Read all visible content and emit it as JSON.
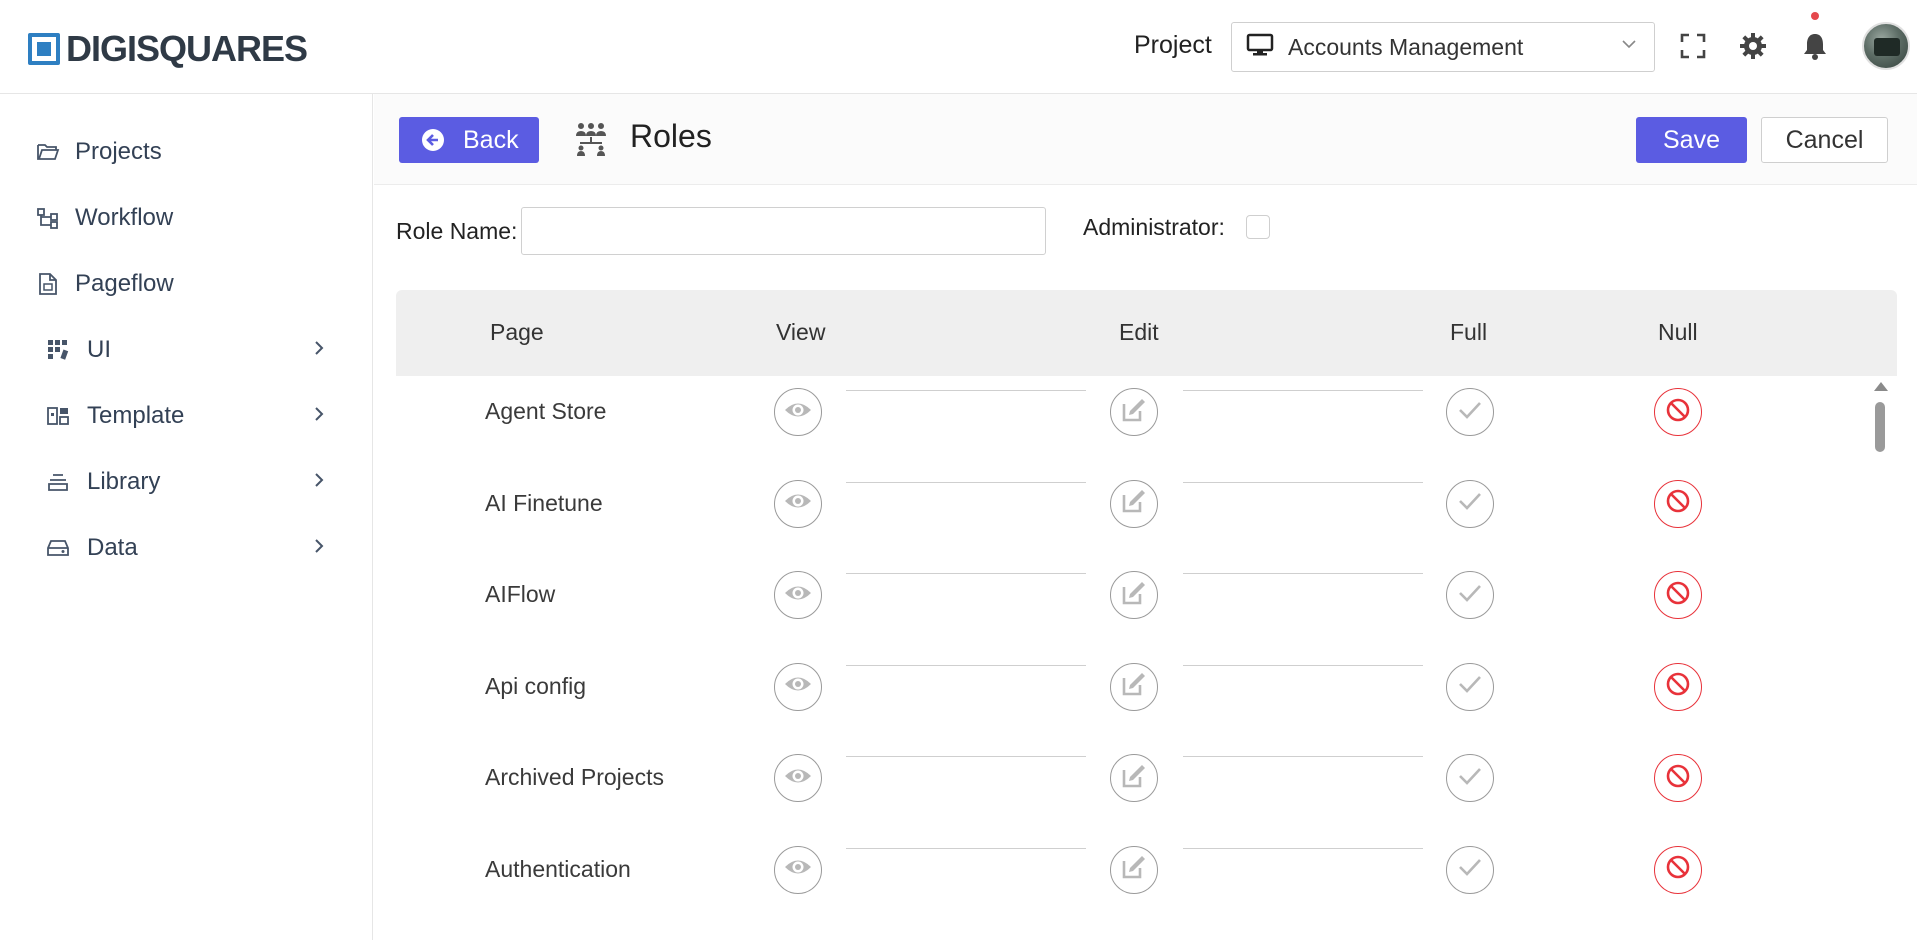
{
  "brand": {
    "name": "DIGISQUARES",
    "color": "#2e7fc2"
  },
  "header": {
    "project_label": "Project",
    "project_value": "Accounts Management",
    "icons": [
      "fullscreen-icon",
      "gear-icon",
      "bell-icon"
    ]
  },
  "sidebar": {
    "items": [
      {
        "label": "Projects",
        "icon": "folder-open-icon",
        "has_submenu": false
      },
      {
        "label": "Workflow",
        "icon": "workflow-icon",
        "has_submenu": false
      },
      {
        "label": "Pageflow",
        "icon": "document-icon",
        "has_submenu": false
      },
      {
        "label": "UI",
        "icon": "grid-icon",
        "has_submenu": true
      },
      {
        "label": "Template",
        "icon": "template-icon",
        "has_submenu": true
      },
      {
        "label": "Library",
        "icon": "library-icon",
        "has_submenu": true
      },
      {
        "label": "Data",
        "icon": "storage-icon",
        "has_submenu": true
      }
    ]
  },
  "toolbar": {
    "back_label": "Back",
    "title": "Roles",
    "save_label": "Save",
    "cancel_label": "Cancel",
    "accent": "#5b5ce2"
  },
  "form": {
    "role_name_label": "Role Name:",
    "role_name_value": "",
    "administrator_label": "Administrator:",
    "administrator_checked": false
  },
  "table": {
    "columns": [
      "Page",
      "View",
      "Edit",
      "Full",
      "Null"
    ],
    "rows": [
      {
        "page": "Agent Store"
      },
      {
        "page": "AI Finetune"
      },
      {
        "page": "AIFlow"
      },
      {
        "page": "Api config"
      },
      {
        "page": "Archived Projects"
      },
      {
        "page": "Authentication"
      }
    ],
    "null_color": "#e8323a"
  }
}
